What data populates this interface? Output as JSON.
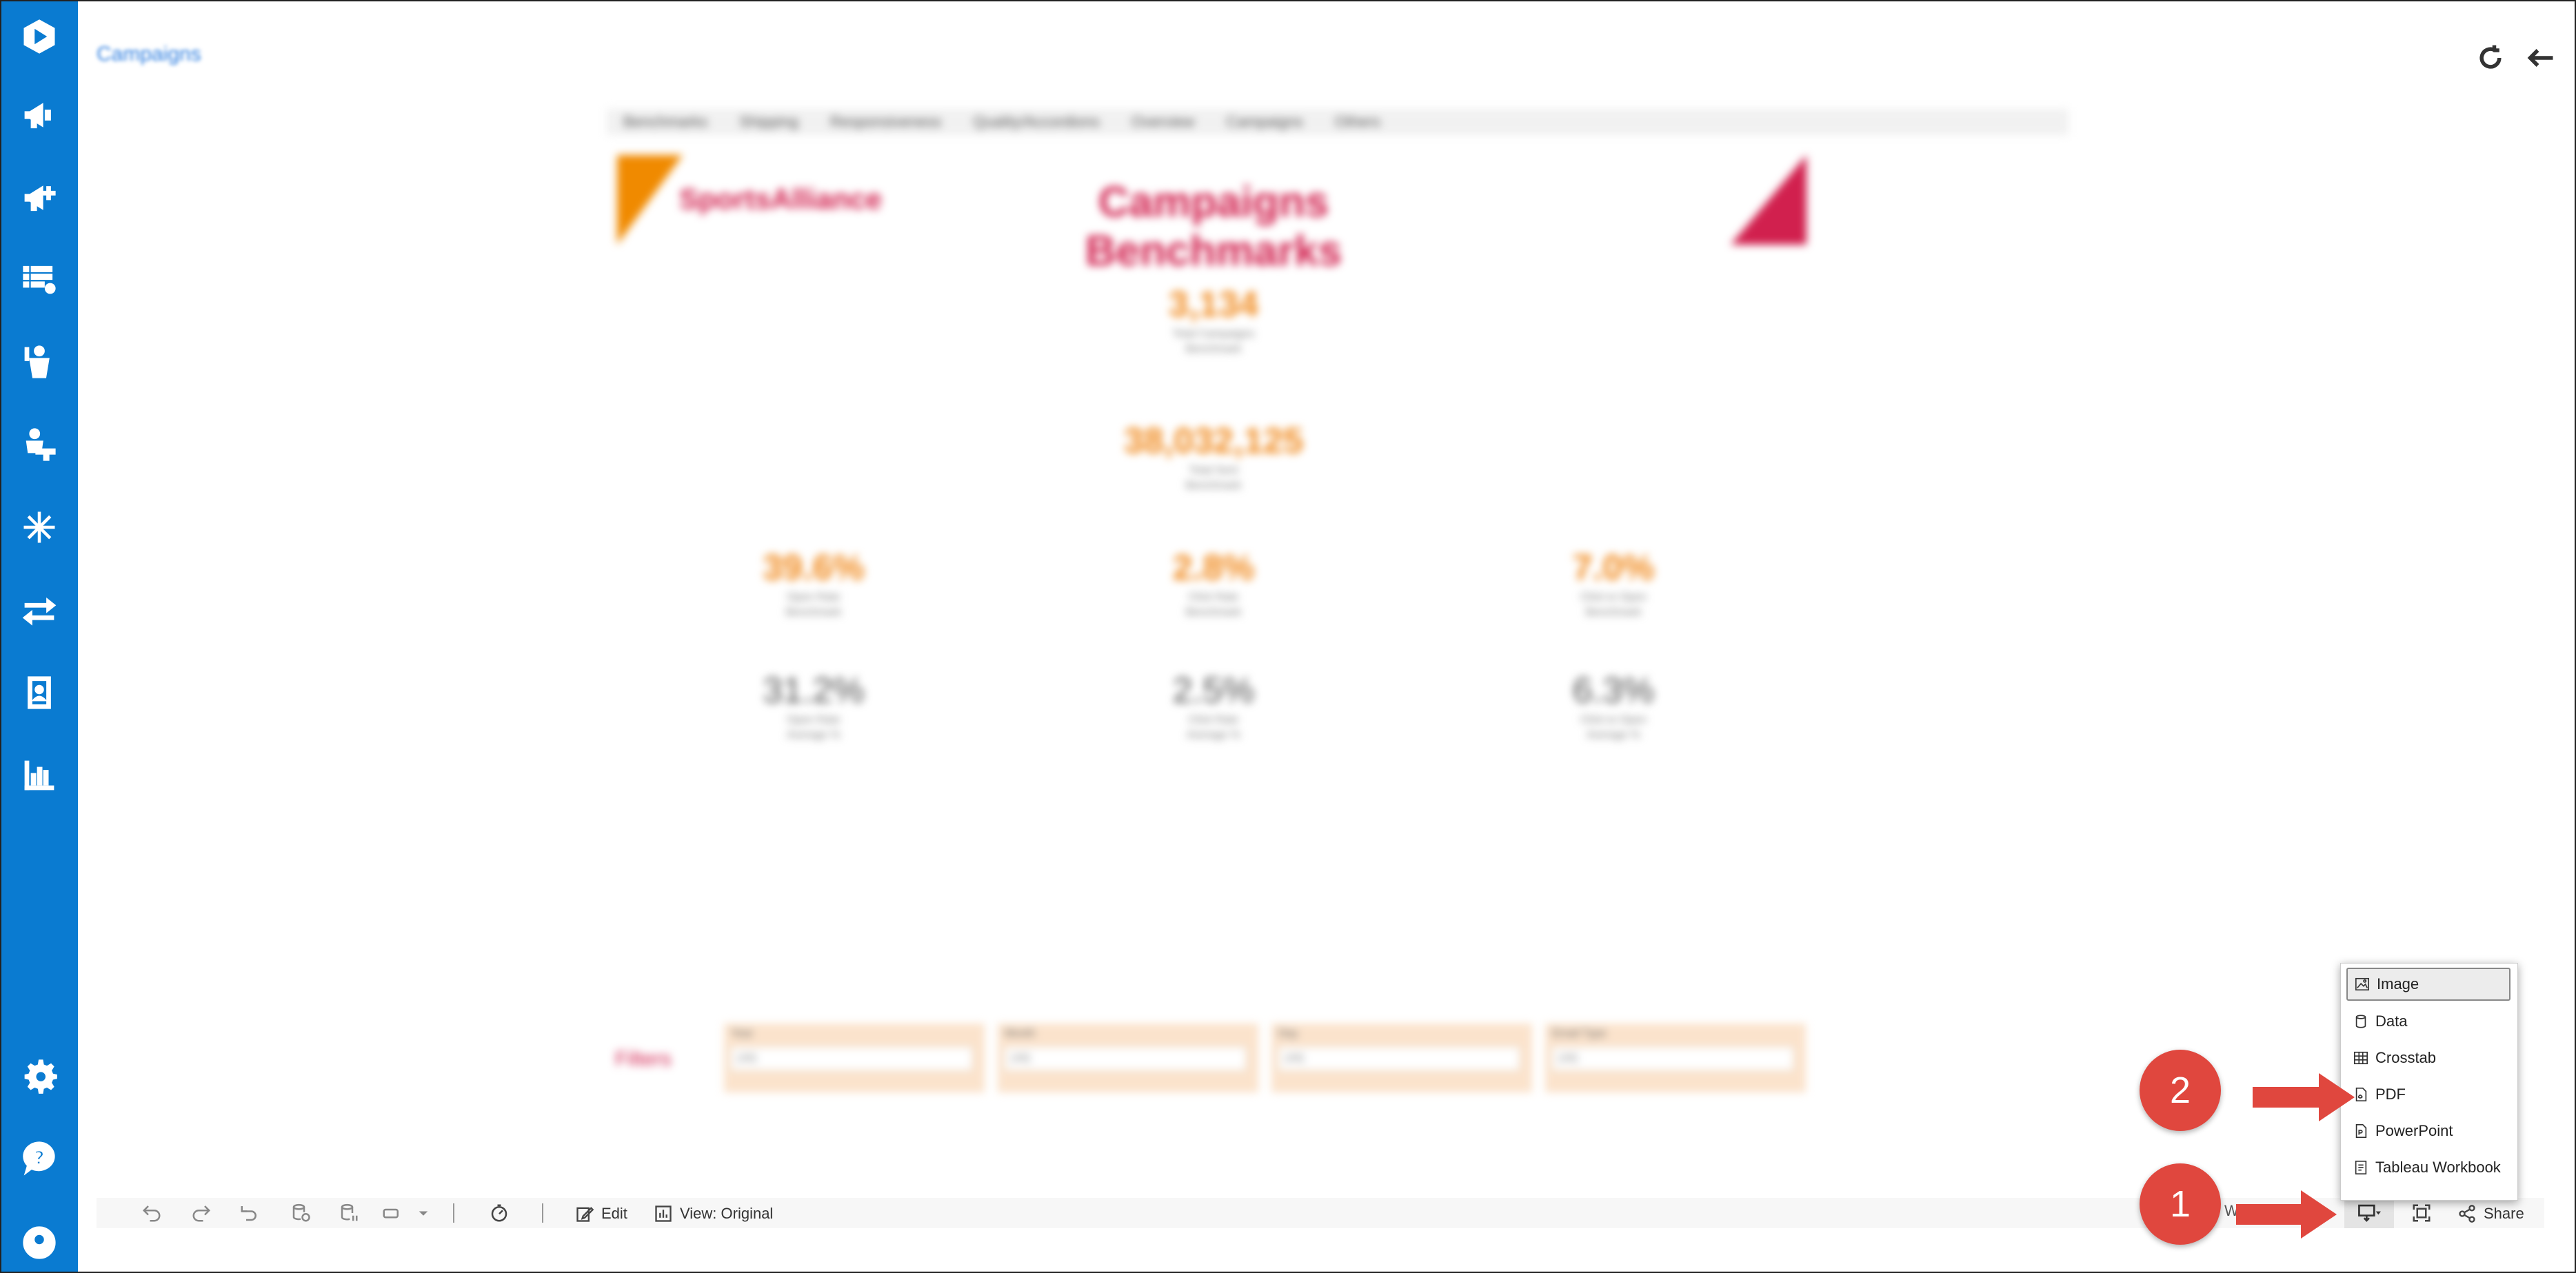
{
  "app": {
    "breadcrumb": "Campaigns",
    "accent_color": "#0a7bd1"
  },
  "sidebar": {
    "icons": [
      "logo-icon",
      "megaphone-icon",
      "megaphone-plus-icon",
      "list-settings-icon",
      "person-raise-icon",
      "person-desk-icon",
      "snowflake-icon",
      "transfer-arrows-icon",
      "contact-card-icon",
      "bar-chart-icon",
      "settings-icon",
      "help-icon",
      "user-icon"
    ]
  },
  "dashboard": {
    "tabs": [
      "Benchmarks",
      "Shipping",
      "Responsiveness",
      "Quality/Accordions",
      "Overview",
      "Campaigns",
      "Others"
    ],
    "logo_text": "SportsAlliance",
    "title": "Campaigns Benchmarks",
    "kpis": [
      {
        "value": "3,134",
        "label1": "Total Campaigns",
        "label2": "Benchmark"
      },
      {
        "value": "38,032,125",
        "label1": "Total Sent",
        "label2": "Benchmark"
      },
      {
        "value": "39.6%",
        "label1": "Open Rate",
        "label2": "Benchmark"
      },
      {
        "value": "2.8%",
        "label1": "Click Rate",
        "label2": "Benchmark"
      },
      {
        "value": "7.0%",
        "label1": "Click to Open",
        "label2": "Benchmark"
      },
      {
        "value": "31.2%",
        "label1": "Open Rate",
        "label2": "Average %"
      },
      {
        "value": "2.5%",
        "label1": "Click Rate",
        "label2": "Average %"
      },
      {
        "value": "6.3%",
        "label1": "Click to Open",
        "label2": "Average %"
      }
    ],
    "filters_label": "Filters",
    "filters": [
      {
        "label": "Year",
        "value": "(All)"
      },
      {
        "label": "Month",
        "value": "(All)"
      },
      {
        "label": "Day",
        "value": "(All)"
      },
      {
        "label": "Email Type",
        "value": "(All)"
      }
    ]
  },
  "toolbar": {
    "edit_label": "Edit",
    "view_label": "View: Original",
    "share_label": "Share",
    "w_fragment": "W"
  },
  "download_menu": {
    "items": [
      {
        "label": "Image",
        "icon": "image-icon",
        "selected": true
      },
      {
        "label": "Data",
        "icon": "database-icon"
      },
      {
        "label": "Crosstab",
        "icon": "grid-icon"
      },
      {
        "label": "PDF",
        "icon": "pdf-icon"
      },
      {
        "label": "PowerPoint",
        "icon": "powerpoint-icon"
      },
      {
        "label": "Tableau Workbook",
        "icon": "workbook-icon"
      }
    ]
  },
  "annotations": {
    "step1": "1",
    "step2": "2",
    "color": "#e0473e"
  }
}
